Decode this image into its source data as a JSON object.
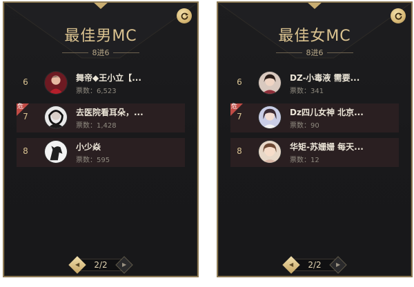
{
  "panels": [
    {
      "title": "最佳男MC",
      "subtitle": "8进6",
      "page": "2/2",
      "rows": [
        {
          "rank": "6",
          "name": "舞帝◆王小立【...",
          "votes": "票数：6,523",
          "flag": ""
        },
        {
          "rank": "7",
          "name": "去医院看耳朵，...",
          "votes": "票数：1,428",
          "flag": "危"
        },
        {
          "rank": "8",
          "name": "小少焱",
          "votes": "票数：595",
          "flag": ""
        }
      ]
    },
    {
      "title": "最佳女MC",
      "subtitle": "8进6",
      "page": "2/2",
      "rows": [
        {
          "rank": "6",
          "name": "DZ-小毒液 需要...",
          "votes": "票数：341",
          "flag": ""
        },
        {
          "rank": "7",
          "name": "Dz四儿女神 北京...",
          "votes": "票数：90",
          "flag": "危"
        },
        {
          "rank": "8",
          "name": "华矩-苏姗姗 每天...",
          "votes": "票数：12",
          "flag": ""
        }
      ]
    }
  ],
  "icons": {
    "refresh": "refresh-icon",
    "prev": "prev-arrow-icon",
    "next": "next-arrow-icon"
  },
  "colors": {
    "gold": "#dcc491",
    "danger": "#c14b45",
    "highlight_row": "#2a1f21"
  }
}
